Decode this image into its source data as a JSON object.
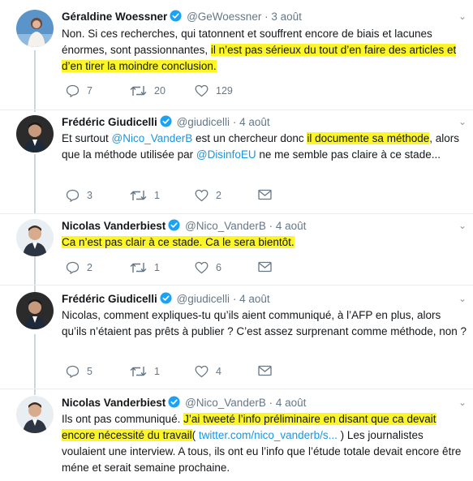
{
  "tweets": [
    {
      "name": "Géraldine Woessner",
      "handle": "@GeWoessner",
      "time": "3 août",
      "text_a": "Non. Si ces recherches, qui tatonnent et souffrent encore de biais et lacunes énormes, sont passionnantes, ",
      "text_hl": "il n’est pas sérieux du tout d’en faire des articles et d’en tirer la moindre conclusion.",
      "replies": "7",
      "retweets": "20",
      "likes": "129"
    },
    {
      "name": "Frédéric Giudicelli",
      "handle": "@giudicelli",
      "time": "4 août",
      "text_a": "Et surtout ",
      "mention1": "@Nico_VanderB",
      "text_b": " est un chercheur donc ",
      "text_hl": "il documente sa méthode",
      "text_c": ", alors que la méthode utilisée par ",
      "mention2": "@DisinfoEU",
      "text_d": " ne me semble pas claire à ce stade...",
      "replies": "3",
      "retweets": "1",
      "likes": "2"
    },
    {
      "name": "Nicolas Vanderbiest",
      "handle": "@Nico_VanderB",
      "time": "4 août",
      "text_hl": "Ca n’est pas clair à ce stade. Ca le sera bientôt.",
      "replies": "2",
      "retweets": "1",
      "likes": "6"
    },
    {
      "name": "Frédéric Giudicelli",
      "handle": "@giudicelli",
      "time": "4 août",
      "text_a": "Nicolas, comment expliques-tu qu’ils aient communiqué, à l’AFP en plus, alors qu’ils n’étaient pas prêts à publier ? C’est assez surprenant comme méthode, non ?",
      "replies": "5",
      "retweets": "1",
      "likes": "4"
    },
    {
      "name": "Nicolas Vanderbiest",
      "handle": "@Nico_VanderB",
      "time": "4 août",
      "text_a": "Ils ont pas communiqué. ",
      "text_hl": "J’ai tweeté l’info préliminaire en disant que ca devait encore nécessité du travail",
      "text_b": "( ",
      "link": "twitter.com/nico_vanderb/s...",
      "text_c": " ) Les journalistes voulaient une interview. A tous, ils ont eu l’info que l’étude totale devait encore être méne et serait semaine prochaine."
    }
  ],
  "separator": "·",
  "colors": {
    "highlight": "#fcf528",
    "link": "#1b95e0",
    "secondary": "#657786",
    "verified": "#1da1f2"
  }
}
